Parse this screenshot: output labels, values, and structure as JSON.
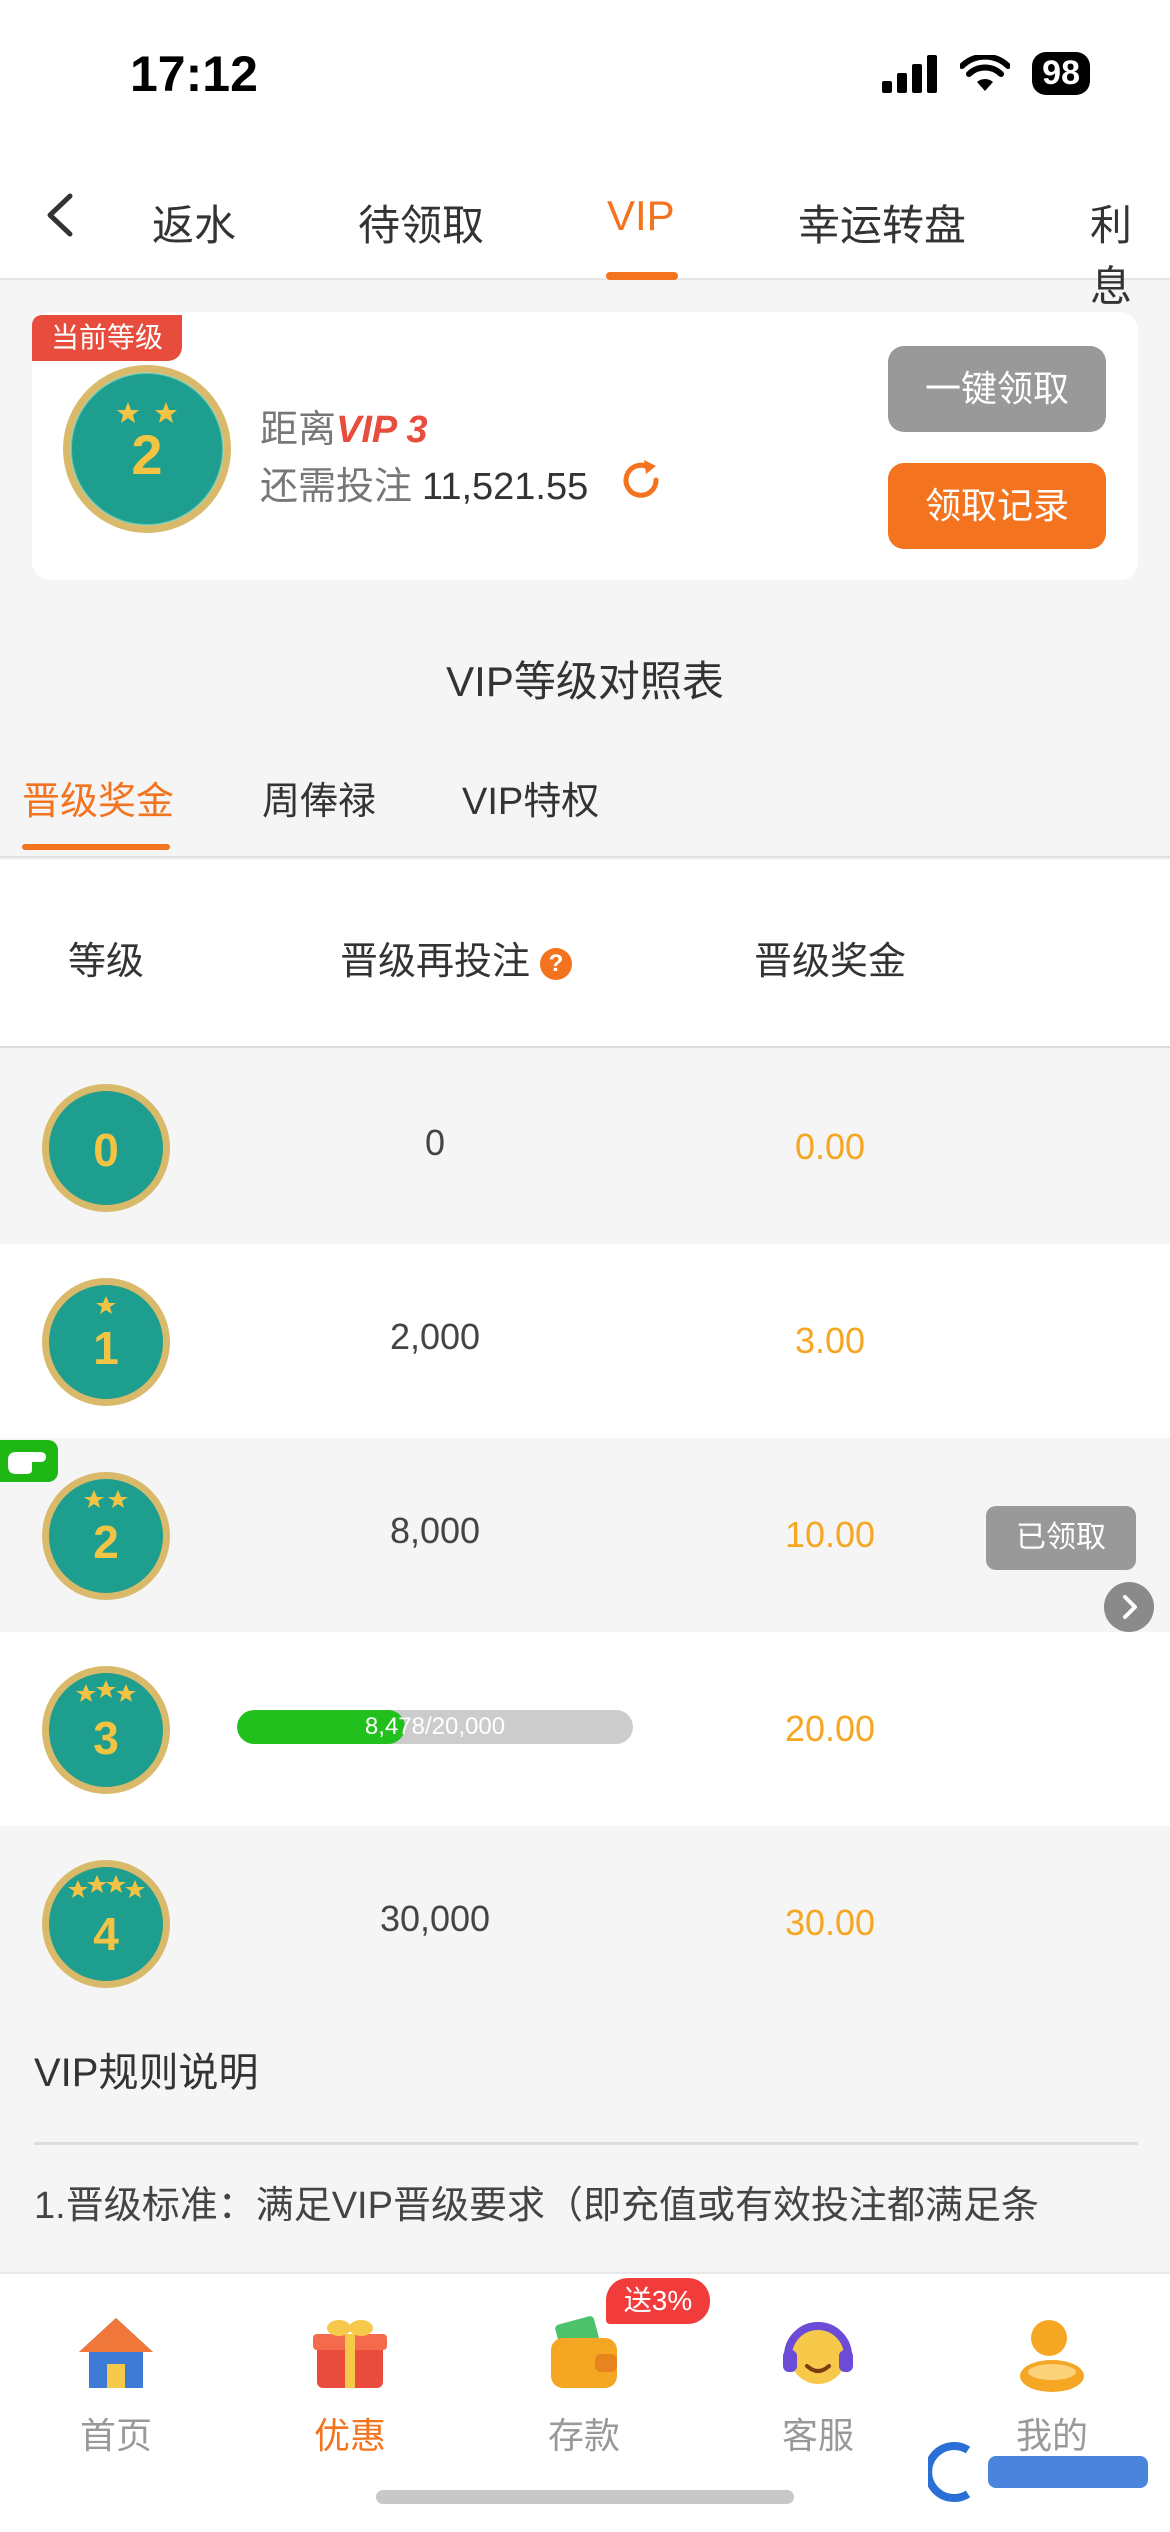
{
  "status_bar": {
    "time": "17:12",
    "battery": "98"
  },
  "tabs": [
    {
      "label": "返水"
    },
    {
      "label": "待领取"
    },
    {
      "label": "VIP"
    },
    {
      "label": "幸运转盘"
    },
    {
      "label": "利息"
    }
  ],
  "card": {
    "tag": "当前等级",
    "current_level": "2",
    "distance_label": "距离",
    "next_vip": "VIP 3",
    "need_label": "还需投注",
    "need_value": "11,521.55",
    "claim_all": "一键领取",
    "claim_record": "领取记录"
  },
  "table_title": "VIP等级对照表",
  "subtabs": [
    {
      "label": "晋级奖金"
    },
    {
      "label": "周俸禄"
    },
    {
      "label": "VIP特权"
    }
  ],
  "table": {
    "headers": {
      "level": "等级",
      "bet": "晋级再投注",
      "help": "?",
      "bonus": "晋级奖金"
    },
    "rows": [
      {
        "level": "0",
        "bet": "0",
        "bonus": "0.00"
      },
      {
        "level": "1",
        "bet": "2,000",
        "bonus": "3.00"
      },
      {
        "level": "2",
        "bet": "8,000",
        "bonus": "10.00",
        "action": "已领取"
      },
      {
        "level": "3",
        "progress_text": "8,478/20,000",
        "progress": 0.4239,
        "bonus": "20.00"
      },
      {
        "level": "4",
        "bet": "30,000",
        "bonus": "30.00"
      }
    ]
  },
  "rules": {
    "title": "VIP规则说明",
    "text": "1.晋级标准：满足VIP晋级要求（即充值或有效投注都满足条"
  },
  "bottom_nav": {
    "items": [
      {
        "label": "首页"
      },
      {
        "label": "优惠"
      },
      {
        "label": "存款"
      },
      {
        "label": "客服"
      },
      {
        "label": "我的"
      }
    ],
    "promo_badge": "送3%"
  },
  "colors": {
    "accent": "#f4731e",
    "bonus": "#f5a623",
    "progress": "#22c01c",
    "tag": "#e74c3c"
  }
}
